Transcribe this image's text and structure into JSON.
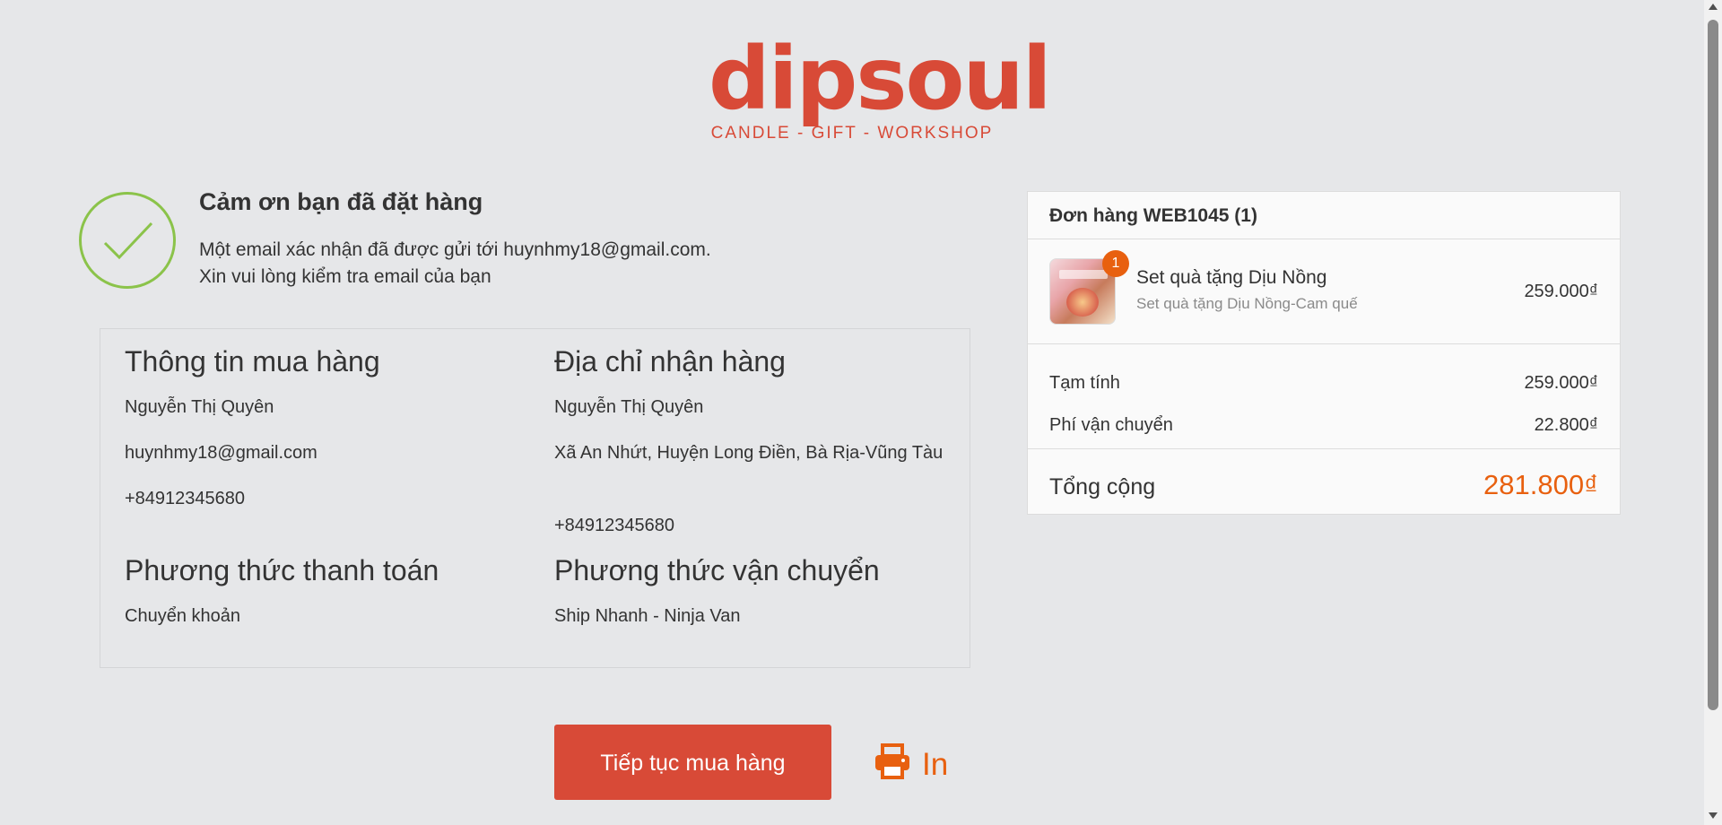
{
  "brand": {
    "name": "dipsoul",
    "tagline": "CANDLE - GIFT - WORKSHOP",
    "color": "#d84a37"
  },
  "confirmation": {
    "title": "Cảm ơn bạn đã đặt hàng",
    "line1": "Một email xác nhận đã được gửi tới huynhmy18@gmail.com.",
    "line2": "Xin vui lòng kiểm tra email của bạn",
    "icon": "check-circle-icon"
  },
  "buyer_info": {
    "heading": "Thông tin mua hàng",
    "name": "Nguyễn Thị Quyên",
    "email": "huynhmy18@gmail.com",
    "phone": "+84912345680"
  },
  "shipping_address": {
    "heading": "Địa chỉ nhận hàng",
    "name": "Nguyễn Thị Quyên",
    "address": "Xã An Nhứt, Huyện Long Điền, Bà Rịa-Vũng Tàu",
    "phone": "+84912345680"
  },
  "payment": {
    "heading": "Phương thức thanh toán",
    "method": "Chuyển khoản"
  },
  "shipping_method": {
    "heading": "Phương thức vận chuyển",
    "method": "Ship Nhanh - Ninja Van"
  },
  "order": {
    "title": "Đơn hàng WEB1045 (1)",
    "items": [
      {
        "quantity": "1",
        "name": "Set quà tặng Dịu Nồng",
        "variant": "Set quà tặng Dịu Nồng-Cam quế",
        "price": "259.000₫"
      }
    ],
    "subtotal_label": "Tạm tính",
    "subtotal": "259.000₫",
    "shipping_label": "Phí vận chuyển",
    "shipping": "22.800₫",
    "total_label": "Tổng cộng",
    "total": "281.800₫",
    "accent": "#e8600f"
  },
  "actions": {
    "continue_label": "Tiếp tục mua hàng",
    "print_label": "In",
    "print_icon": "printer-icon"
  }
}
